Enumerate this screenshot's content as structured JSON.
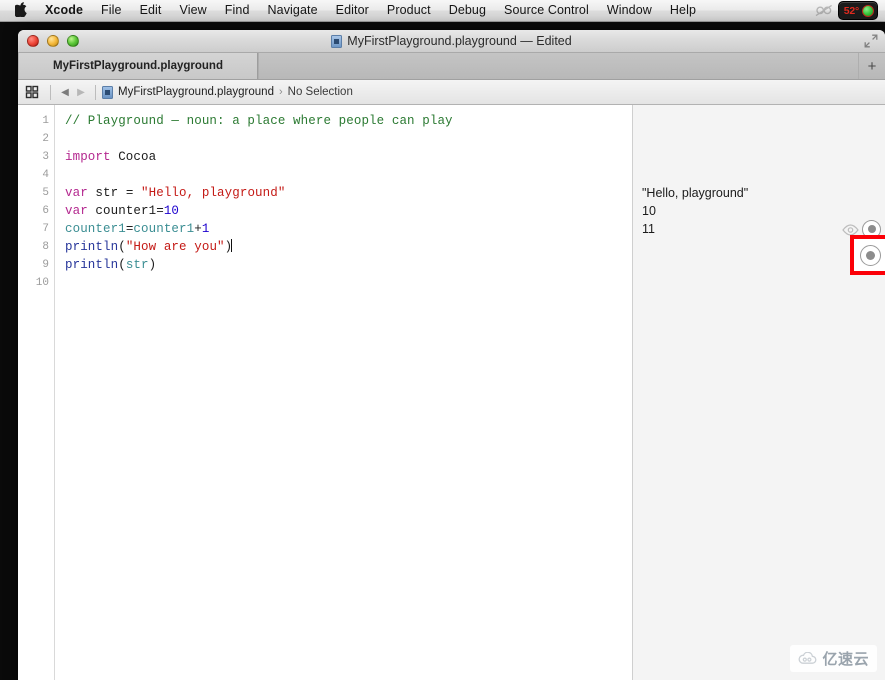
{
  "menubar": {
    "apple_icon": "apple-logo-icon",
    "items": [
      {
        "label": "Xcode",
        "bold": true
      },
      {
        "label": "File",
        "bold": false
      },
      {
        "label": "Edit",
        "bold": false
      },
      {
        "label": "View",
        "bold": false
      },
      {
        "label": "Find",
        "bold": false
      },
      {
        "label": "Navigate",
        "bold": false
      },
      {
        "label": "Editor",
        "bold": false
      },
      {
        "label": "Product",
        "bold": false
      },
      {
        "label": "Debug",
        "bold": false
      },
      {
        "label": "Source Control",
        "bold": false
      },
      {
        "label": "Window",
        "bold": false
      },
      {
        "label": "Help",
        "bold": false
      }
    ],
    "status": {
      "creative_cloud_icon": "creative-cloud-icon",
      "temperature": "52°",
      "temperature_color": "#e02a1e"
    }
  },
  "window": {
    "title": "MyFirstPlayground.playground — Edited",
    "title_icon": "playground-document-icon",
    "close_label": "Close",
    "minimize_label": "Minimize",
    "zoom_label": "Zoom",
    "fullscreen_icon": "fullscreen-arrows-icon"
  },
  "tabbar": {
    "tabs": [
      {
        "label": "MyFirstPlayground.playground",
        "active": true
      }
    ],
    "add_tab_label": "+"
  },
  "breadcrumb": {
    "grid_icon": "grid-view-icon",
    "back_arrow": "◀",
    "forward_arrow": "▶",
    "doc_icon": "playground-document-icon",
    "file": "MyFirstPlayground.playground",
    "separator": "›",
    "selection": "No Selection"
  },
  "editor": {
    "line_numbers": [
      "1",
      "2",
      "3",
      "4",
      "5",
      "6",
      "7",
      "8",
      "9",
      "10"
    ],
    "lines": [
      {
        "n": 1,
        "tokens": [
          {
            "t": "// Playground — noun: a place where people can play",
            "c": "tok-comment"
          }
        ]
      },
      {
        "n": 2,
        "tokens": []
      },
      {
        "n": 3,
        "tokens": [
          {
            "t": "import",
            "c": "tok-keyword"
          },
          {
            "t": " Cocoa",
            "c": "tok-plain"
          }
        ]
      },
      {
        "n": 4,
        "tokens": []
      },
      {
        "n": 5,
        "tokens": [
          {
            "t": "var",
            "c": "tok-keyword"
          },
          {
            "t": " str = ",
            "c": "tok-plain"
          },
          {
            "t": "\"Hello, playground\"",
            "c": "tok-string"
          }
        ]
      },
      {
        "n": 6,
        "tokens": [
          {
            "t": "var",
            "c": "tok-keyword"
          },
          {
            "t": " counter1=",
            "c": "tok-plain"
          },
          {
            "t": "10",
            "c": "tok-number"
          }
        ]
      },
      {
        "n": 7,
        "tokens": [
          {
            "t": "counter1",
            "c": "tok-ident"
          },
          {
            "t": "=",
            "c": "tok-plain"
          },
          {
            "t": "counter1",
            "c": "tok-ident"
          },
          {
            "t": "+",
            "c": "tok-plain"
          },
          {
            "t": "1",
            "c": "tok-number"
          }
        ]
      },
      {
        "n": 8,
        "tokens": [
          {
            "t": "println",
            "c": "tok-func"
          },
          {
            "t": "(",
            "c": "tok-plain"
          },
          {
            "t": "\"How are you\"",
            "c": "tok-string"
          },
          {
            "t": ")",
            "c": "tok-plain"
          }
        ],
        "caret": true
      },
      {
        "n": 9,
        "tokens": [
          {
            "t": "println",
            "c": "tok-func"
          },
          {
            "t": "(",
            "c": "tok-plain"
          },
          {
            "t": "str",
            "c": "tok-ident"
          },
          {
            "t": ")",
            "c": "tok-plain"
          }
        ]
      },
      {
        "n": 10,
        "tokens": []
      }
    ]
  },
  "results": {
    "rows": [
      {
        "line": 5,
        "value": "\"Hello, playground\"",
        "actions": false
      },
      {
        "line": 6,
        "value": "10",
        "actions": false
      },
      {
        "line": 7,
        "value": "11",
        "actions": true
      }
    ],
    "quicklook_icon": "quick-look-eye-icon",
    "value_history_icon": "value-history-circle-icon"
  },
  "annotation": {
    "highlight_color": "#fb0007",
    "target": "value-history-button"
  },
  "watermark": {
    "text": "亿速云",
    "logo_icon": "cloud-logo-icon"
  }
}
